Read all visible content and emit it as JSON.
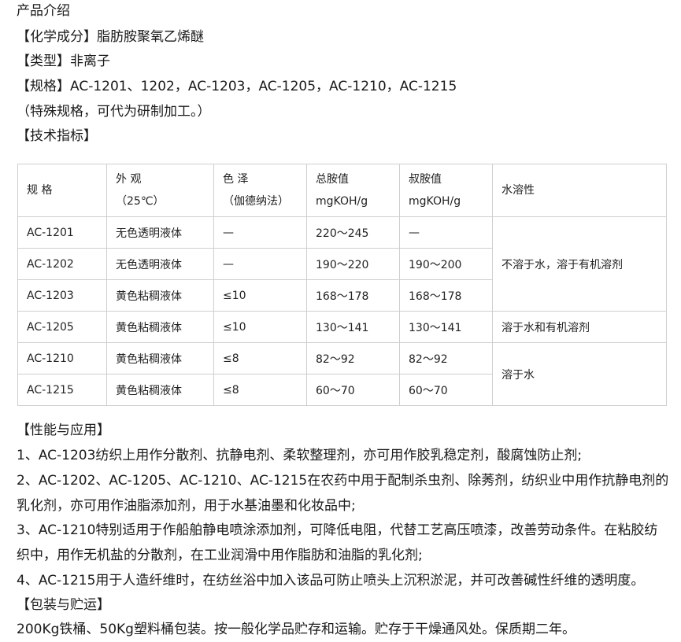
{
  "intro": {
    "title": "产品介绍",
    "composition": "【化学成分】脂肪胺聚氧乙烯醚",
    "type": "【类型】非离子",
    "spec": "【规格】AC-1201、1202，AC-1203，AC-1205，AC-1210，AC-1215",
    "spec_note": "（特殊规格，可代为研制加工。）",
    "tech_heading": "【技术指标】"
  },
  "table": {
    "headers": [
      {
        "line1": "规 格",
        "line2": ""
      },
      {
        "line1": "外 观",
        "line2": "（25℃）"
      },
      {
        "line1": "色 泽",
        "line2": "（伽德纳法）"
      },
      {
        "line1": "总胺值",
        "line2": "mgKOH/g"
      },
      {
        "line1": "叔胺值",
        "line2": "mgKOH/g"
      },
      {
        "line1": "水溶性",
        "line2": ""
      }
    ],
    "rows": [
      [
        "AC-1201",
        "无色透明液体",
        "—",
        "220～245",
        "—"
      ],
      [
        "AC-1202",
        "无色透明液体",
        "—",
        "190～220",
        "190～200"
      ],
      [
        "AC-1203",
        "黄色粘稠液体",
        "≤10",
        "168～178",
        "168～178"
      ],
      [
        "AC-1205",
        "黄色粘稠液体",
        "≤10",
        "130～141",
        "130～141"
      ],
      [
        "AC-1210",
        "黄色粘稠液体",
        "≤8",
        "82～92",
        "82～92"
      ],
      [
        "AC-1215",
        "黄色粘稠液体",
        "≤8",
        "60～70",
        "60～70"
      ]
    ],
    "solubility": [
      "不溶于水，溶于有机溶剂",
      "溶于水和有机溶剂",
      "溶于水"
    ]
  },
  "applications": {
    "heading": "【性能与应用】",
    "items": [
      "1、AC-1203纺织上用作分散剂、抗静电剂、柔软整理剂，亦可用作胶乳稳定剂，酸腐蚀防止剂;",
      "2、AC-1202、AC-1205、AC-1210、AC-1215在农药中用于配制杀虫剂、除莠剂，纺织业中用作抗静电剂的乳化剂，亦可用作油脂添加剂，用于水基油墨和化妆品中;",
      "3、AC-1210特别适用于作船舶静电喷涂添加剂，可降低电阻，代替工艺高压喷漆，改善劳动条件。在粘胶纺织中，用作无机盐的分散剂，在工业润滑中用作脂肪和油脂的乳化剂;",
      "4、AC-1215用于人造纤维时，在纺丝浴中加入该品可防止喷头上沉积淤泥，并可改善碱性纤维的透明度。"
    ]
  },
  "packaging": {
    "heading": "【包装与贮运】",
    "text": "200Kg铁桶、50Kg塑料桶包装。按一般化学品贮存和运输。贮存于干燥通风处。保质期二年。"
  }
}
